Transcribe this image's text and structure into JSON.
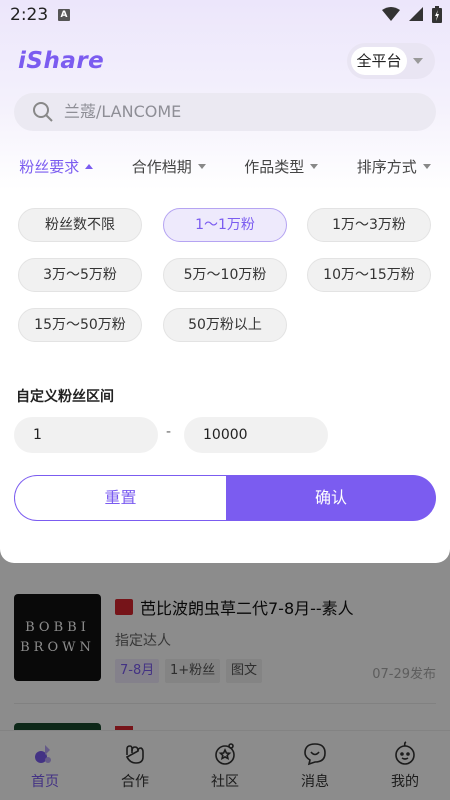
{
  "status_bar": {
    "time": "2:23",
    "notification_letter": "A"
  },
  "header": {
    "logo": "iShare",
    "platform_label": "全平台"
  },
  "search": {
    "placeholder": "兰蔻/LANCOME"
  },
  "filter_tabs": [
    {
      "label": "粉丝要求",
      "active": true
    },
    {
      "label": "合作档期",
      "active": false
    },
    {
      "label": "作品类型",
      "active": false
    },
    {
      "label": "排序方式",
      "active": false
    }
  ],
  "fan_filter": {
    "options": [
      "粉丝数不限",
      "1～1万粉",
      "1万～3万粉",
      "3万～5万粉",
      "5万～10万粉",
      "10万～15万粉",
      "15万～50万粉",
      "50万粉以上"
    ],
    "selected": "1～1万粉",
    "custom_title": "自定义粉丝区间",
    "min_value": "1",
    "max_value": "10000",
    "range_separator": "-",
    "reset_label": "重置",
    "confirm_label": "确认"
  },
  "list": [
    {
      "image_text": [
        "BOBBI",
        "BROWN"
      ],
      "title": "芭比波朗虫草二代7-8月--素人",
      "subtitle": "指定达人",
      "tags": [
        "7-8月",
        "1+粉丝",
        "图文"
      ],
      "date": "07-29发布"
    }
  ],
  "bottom_nav": [
    {
      "label": "首页",
      "icon": "home-icon",
      "active": true
    },
    {
      "label": "合作",
      "icon": "handshake-icon",
      "active": false
    },
    {
      "label": "社区",
      "icon": "community-icon",
      "active": false
    },
    {
      "label": "消息",
      "icon": "message-icon",
      "active": false
    },
    {
      "label": "我的",
      "icon": "profile-icon",
      "active": false
    }
  ],
  "colors": {
    "accent": "#7b5cf0",
    "chip_bg": "#f1f1f1",
    "overlay": "rgba(0,0,0,0.45)"
  }
}
